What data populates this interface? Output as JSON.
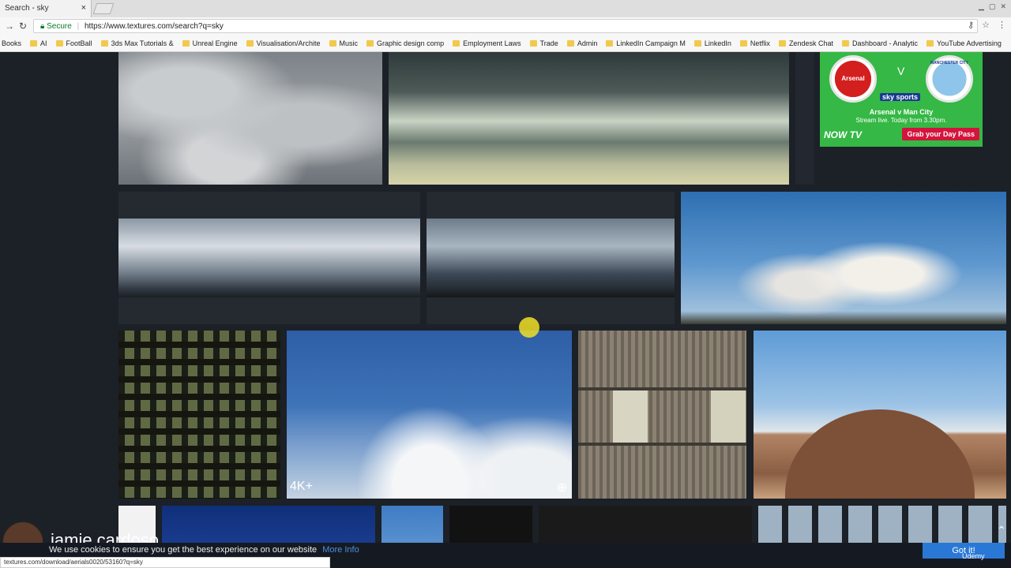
{
  "browser": {
    "tab_title": "Search - sky",
    "tab_close": "×",
    "secure_label": "Secure",
    "url": "https://www.textures.com/search?q=sky",
    "status_url": "textures.com/download/aerials0020/53160?q=sky",
    "bookmarks": [
      "Books",
      "AI",
      "FootBall",
      "3ds Max Tutorials &",
      "Unreal Engine",
      "Visualisation/Archite",
      "Music",
      "Graphic design comp",
      "Employment Laws",
      "Trade",
      "Admin",
      "LinkedIn Campaign M",
      "LinkedIn",
      "Netflix",
      "Zendesk Chat",
      "Dashboard - Analytic",
      "YouTube Advertising"
    ]
  },
  "results": {
    "badge_4k": "4K+",
    "zoom_icon": "⊕"
  },
  "ad": {
    "versus": "V",
    "broadcaster": "sky sports",
    "home_crest": "Arsenal",
    "away_crest": "MANCHESTER CITY",
    "title": "Arsenal v Man City",
    "subtitle": "Stream live. Today from 3.30pm.",
    "logo": "NOW TV",
    "cta": "Grab your Day Pass"
  },
  "cookie": {
    "text": "We use cookies to ensure you get the best experience on our website",
    "link": "More Info",
    "button": "Got it!"
  },
  "overlay": {
    "presenter": "jamie cardoso",
    "brand": "Udemy"
  },
  "colors": {
    "page_bg": "#1c2027",
    "ad_green": "#35b845",
    "ad_cta": "#d4143c",
    "button_blue": "#2a78d6"
  }
}
